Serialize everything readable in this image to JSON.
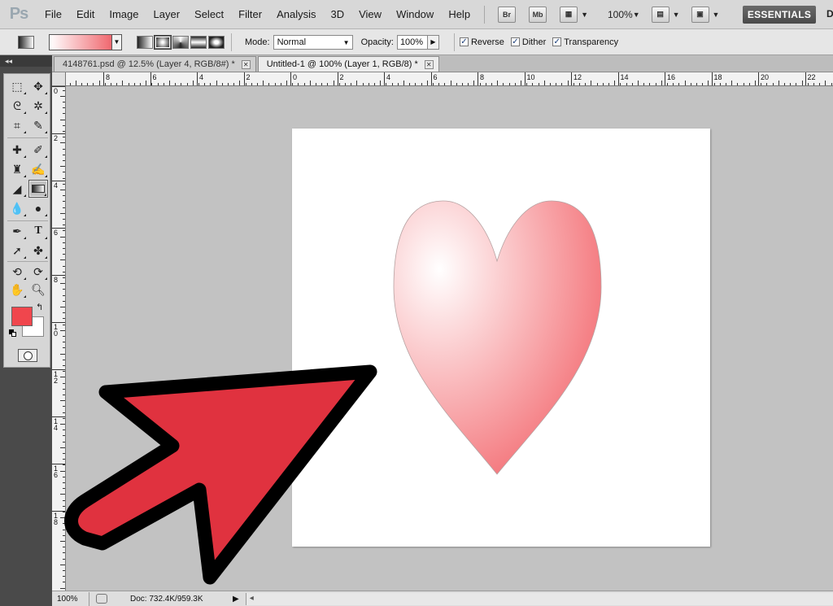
{
  "app": {
    "logo": "Ps",
    "menu": [
      "File",
      "Edit",
      "Image",
      "Layer",
      "Select",
      "Filter",
      "Analysis",
      "3D",
      "View",
      "Window",
      "Help"
    ],
    "bridge_label": "Br",
    "minibridge_label": "Mb",
    "zoom_level": "100%",
    "workspace_label": "ESSENTIALS",
    "workspace_more": "D"
  },
  "options": {
    "mode_label": "Mode:",
    "mode_value": "Normal",
    "opacity_label": "Opacity:",
    "opacity_value": "100%",
    "reverse_label": "Reverse",
    "dither_label": "Dither",
    "transparency_label": "Transparency",
    "gradient_colors": [
      "#ffffff",
      "#f0686f"
    ]
  },
  "tabs": [
    {
      "label": "4148761.psd @ 12.5% (Layer 4, RGB/8#) *",
      "active": false
    },
    {
      "label": "Untitled-1 @ 100% (Layer 1, RGB/8) *",
      "active": true
    }
  ],
  "tools": {
    "foreground_color": "#f0464d",
    "background_color": "#ffffff"
  },
  "rulers": {
    "top": [
      "8",
      "6",
      "4",
      "2",
      "0",
      "2",
      "4",
      "6",
      "8",
      "10",
      "12",
      "14",
      "16",
      "18",
      "20",
      "22"
    ],
    "left": [
      "0",
      "2",
      "4",
      "6",
      "8",
      "10",
      "12",
      "14",
      "16",
      "18"
    ]
  },
  "status": {
    "zoom": "100%",
    "doc_info": "Doc: 732.4K/959.3K"
  },
  "artwork": {
    "heart_colors": [
      "#ffffff",
      "#f36a70"
    ],
    "arrow_fill": "#e0323f",
    "arrow_stroke": "#000000"
  }
}
